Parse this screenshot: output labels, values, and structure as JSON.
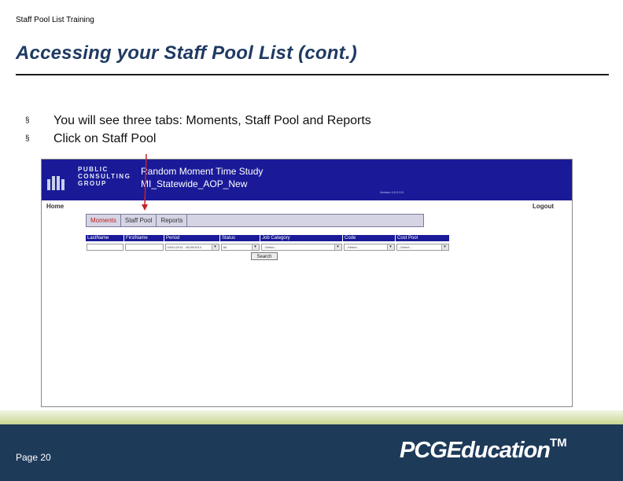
{
  "header": {
    "small_title": "Staff Pool List Training",
    "title": "Accessing your Staff Pool List (cont.)"
  },
  "bullets": [
    {
      "marker": "§",
      "text": "You will see three tabs: Moments, Staff Pool and Reports"
    },
    {
      "marker": "§",
      "text": "Click on Staff Pool"
    }
  ],
  "app": {
    "logo_lines": [
      "PUBLIC",
      "CONSULTING",
      "GROUP"
    ],
    "title_line1": "Random Moment Time Study",
    "title_line2": "MI_Statewide_AOP_New",
    "version": "Version 4.0.0.0.0",
    "nav": {
      "home": "Home",
      "logout": "Logout"
    },
    "tabs": [
      {
        "label": "Moments",
        "active": true
      },
      {
        "label": "Staff Pool",
        "active": false
      },
      {
        "label": "Reports",
        "active": false
      }
    ],
    "filters": {
      "headers": [
        "LastName",
        "FirstName",
        "Period",
        "Status",
        "Job Category",
        "Code",
        "Cost Pool"
      ],
      "period_value": "04/01/2014 - 06/30/2014",
      "status_value": "All",
      "job_category_value": "--Select--",
      "code_value": "--Select--",
      "cost_pool_value": "--Select--",
      "search_label": "Search"
    },
    "accent_color": "#1a1a99"
  },
  "footer": {
    "page_label": "Page 20",
    "brand": "PCGEducation",
    "trademark": "TM"
  },
  "pointer_color": "#cc2222"
}
